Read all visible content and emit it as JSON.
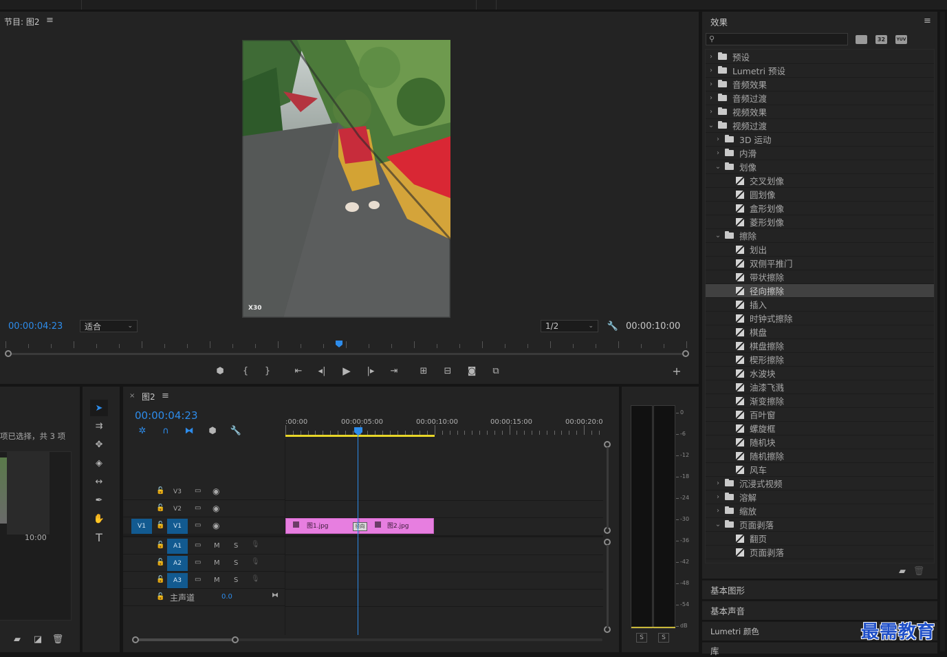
{
  "program_monitor": {
    "title": "节目: 图2",
    "timecode_left": "00:00:04:23",
    "fit_label": "适合",
    "resolution": "1/2",
    "timecode_right": "00:00:10:00",
    "watermark": "X30"
  },
  "project": {
    "selection_text": "项已选择，共 3 项",
    "clip_duration": "10:00"
  },
  "timeline": {
    "tab_title": "图2",
    "timecode": "00:00:04:23",
    "ruler": [
      ":00:00",
      "00:00:05:00",
      "00:00:10:00",
      "00:00:15:00",
      "00:00:20:00"
    ],
    "tracks_video": [
      {
        "label": "V3"
      },
      {
        "label": "V2"
      },
      {
        "label": "V1",
        "source": "V1"
      }
    ],
    "tracks_audio": [
      {
        "label": "A1",
        "m": "M",
        "s": "S"
      },
      {
        "label": "A2",
        "m": "M",
        "s": "S"
      },
      {
        "label": "A3",
        "m": "M",
        "s": "S"
      }
    ],
    "master": {
      "label": "主声道",
      "value": "0.0"
    },
    "clips": [
      {
        "name": "图1.jpg"
      },
      {
        "name": "图2.jpg"
      }
    ],
    "transition_label": "径向"
  },
  "audio_meter": {
    "scale": [
      "0",
      "-6",
      "-12",
      "-18",
      "-24",
      "-30",
      "-36",
      "-42",
      "-48",
      "-54",
      "dB"
    ],
    "solo_left": "S",
    "solo_right": "S"
  },
  "effects": {
    "title": "效果",
    "search_placeholder": "",
    "filter_btns": [
      "32",
      "YUV"
    ],
    "tree": [
      {
        "label": "预设",
        "level": 0,
        "kind": "folder",
        "open": false
      },
      {
        "label": "Lumetri 预设",
        "level": 0,
        "kind": "folder",
        "open": false
      },
      {
        "label": "音频效果",
        "level": 0,
        "kind": "folder",
        "open": false
      },
      {
        "label": "音频过渡",
        "level": 0,
        "kind": "folder",
        "open": false
      },
      {
        "label": "视频效果",
        "level": 0,
        "kind": "folder",
        "open": false
      },
      {
        "label": "视频过渡",
        "level": 0,
        "kind": "folder",
        "open": true
      },
      {
        "label": "3D 运动",
        "level": 1,
        "kind": "folder",
        "open": false
      },
      {
        "label": "内滑",
        "level": 1,
        "kind": "folder",
        "open": false
      },
      {
        "label": "划像",
        "level": 1,
        "kind": "folder",
        "open": true
      },
      {
        "label": "交叉划像",
        "level": 2,
        "kind": "fx"
      },
      {
        "label": "圆划像",
        "level": 2,
        "kind": "fx"
      },
      {
        "label": "盒形划像",
        "level": 2,
        "kind": "fx"
      },
      {
        "label": "菱形划像",
        "level": 2,
        "kind": "fx"
      },
      {
        "label": "擦除",
        "level": 1,
        "kind": "folder",
        "open": true
      },
      {
        "label": "划出",
        "level": 2,
        "kind": "fx"
      },
      {
        "label": "双侧平推门",
        "level": 2,
        "kind": "fx"
      },
      {
        "label": "带状擦除",
        "level": 2,
        "kind": "fx"
      },
      {
        "label": "径向擦除",
        "level": 2,
        "kind": "fx",
        "selected": true
      },
      {
        "label": "插入",
        "level": 2,
        "kind": "fx"
      },
      {
        "label": "时钟式擦除",
        "level": 2,
        "kind": "fx"
      },
      {
        "label": "棋盘",
        "level": 2,
        "kind": "fx"
      },
      {
        "label": "棋盘擦除",
        "level": 2,
        "kind": "fx"
      },
      {
        "label": "楔形擦除",
        "level": 2,
        "kind": "fx"
      },
      {
        "label": "水波块",
        "level": 2,
        "kind": "fx"
      },
      {
        "label": "油漆飞溅",
        "level": 2,
        "kind": "fx"
      },
      {
        "label": "渐变擦除",
        "level": 2,
        "kind": "fx"
      },
      {
        "label": "百叶窗",
        "level": 2,
        "kind": "fx"
      },
      {
        "label": "螺旋框",
        "level": 2,
        "kind": "fx"
      },
      {
        "label": "随机块",
        "level": 2,
        "kind": "fx"
      },
      {
        "label": "随机擦除",
        "level": 2,
        "kind": "fx"
      },
      {
        "label": "风车",
        "level": 2,
        "kind": "fx"
      },
      {
        "label": "沉浸式视频",
        "level": 1,
        "kind": "folder",
        "open": false
      },
      {
        "label": "溶解",
        "level": 1,
        "kind": "folder",
        "open": false
      },
      {
        "label": "缩放",
        "level": 1,
        "kind": "folder",
        "open": false
      },
      {
        "label": "页面剥落",
        "level": 1,
        "kind": "folder",
        "open": true
      },
      {
        "label": "翻页",
        "level": 2,
        "kind": "fx"
      },
      {
        "label": "页面剥落",
        "level": 2,
        "kind": "fx"
      }
    ]
  },
  "bottom_panels": [
    "基本图形",
    "基本声音",
    "Lumetri 颜色",
    "库"
  ],
  "brand_watermark": "最需教育",
  "colors": {
    "accent": "#2d8ceb",
    "clip": "#e77ee0",
    "track_active": "#125a90"
  }
}
